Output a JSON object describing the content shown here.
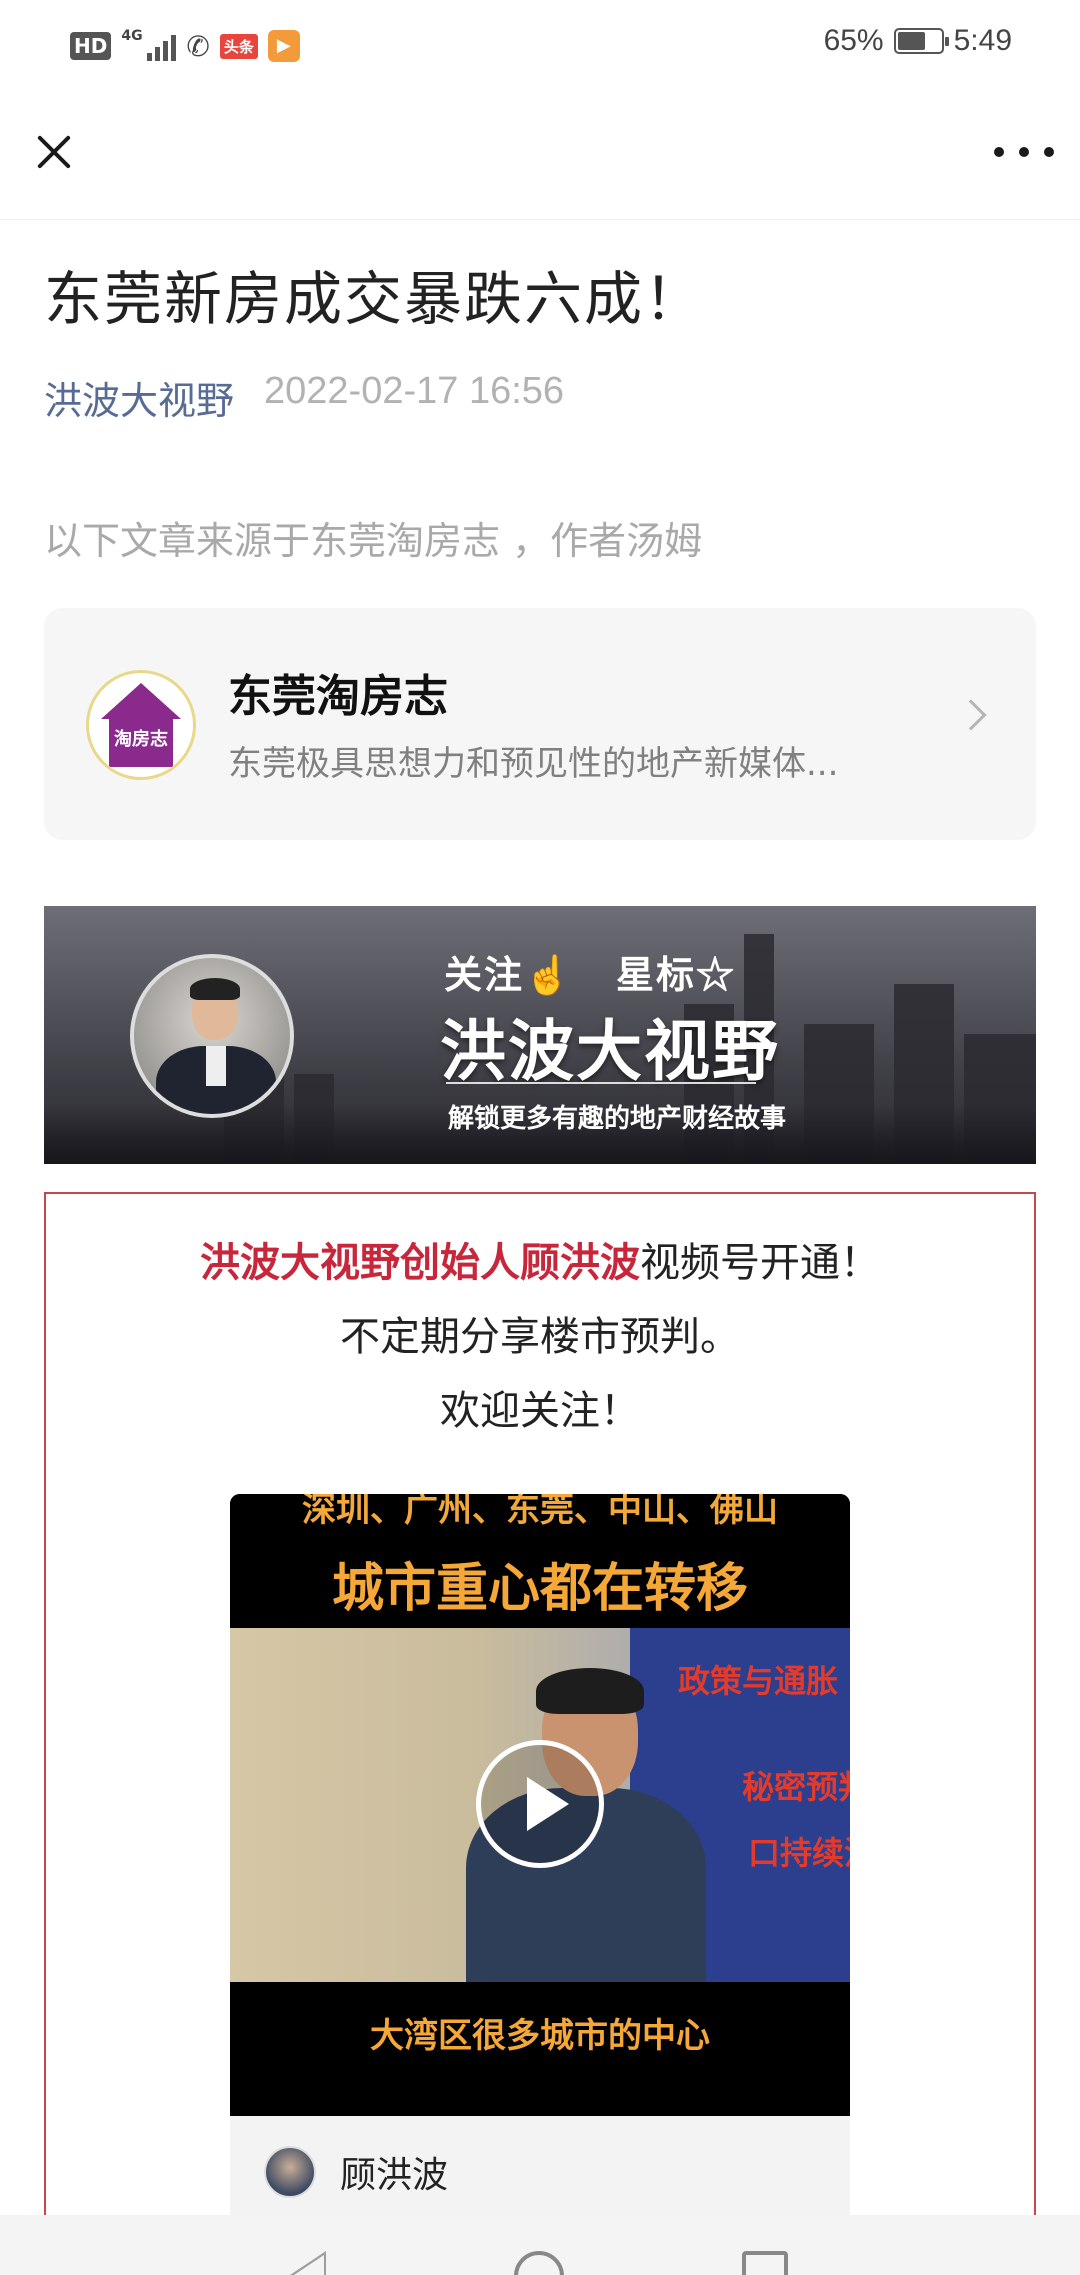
{
  "status_bar": {
    "hd": "HD",
    "network": "4G",
    "toutiao": "头条",
    "battery_percent": "65%",
    "battery_level": 0.65,
    "time": "5:49"
  },
  "nav": {
    "close_icon": "close-icon",
    "more_icon": "more-icon"
  },
  "article": {
    "title": "东莞新房成交暴跌六成！",
    "author": "洪波大视野",
    "date": "2022-02-17 16:56",
    "source_note": "以下文章来源于东莞淘房志 ，作者汤姆"
  },
  "source_card": {
    "logo_text": "淘房志",
    "name": "东莞淘房志",
    "description": "东莞极具思想力和预见性的地产新媒体..."
  },
  "banner": {
    "follow": "关注☝",
    "star": "星标☆",
    "title": "洪波大视野",
    "subtitle": "解锁更多有趣的地产财经故事"
  },
  "promo": {
    "line1_highlight": "洪波大视野创始人顾洪波",
    "line1_rest": "视频号开通！",
    "line2": "不定期分享楼市预判。",
    "line3": "欢迎关注！"
  },
  "video": {
    "top_cities": "深圳、广州、东莞、中山、佛山",
    "top_caption": "城市重心都在转移",
    "screen_text_1": "政策与通胀",
    "screen_text_2": "秘密预判二",
    "screen_text_3": "口持续流入",
    "bottom_caption": "大湾区很多城市的中心",
    "author_name": "顾洪波"
  },
  "colors": {
    "author_link": "#576b95",
    "highlight_red": "#c7263b",
    "box_border": "#c5484a",
    "video_caption": "#f5a838"
  }
}
